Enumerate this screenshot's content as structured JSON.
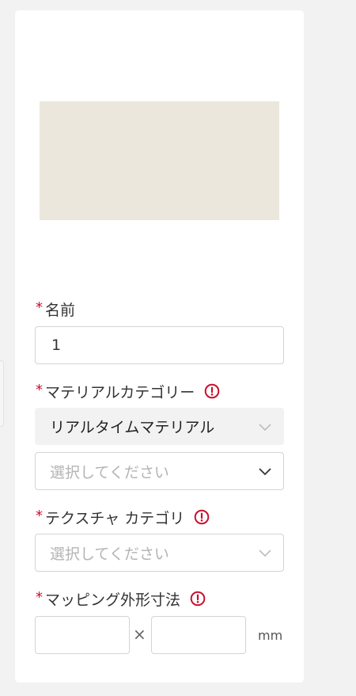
{
  "form": {
    "name": {
      "required_mark": "*",
      "label": "名前",
      "value": "1"
    },
    "material_category": {
      "required_mark": "*",
      "label": "マテリアルカテゴリー",
      "primary_value": "リアルタイムマテリアル",
      "secondary_placeholder": "選択してください"
    },
    "texture_category": {
      "required_mark": "*",
      "label": "テクスチャ カテゴリ",
      "placeholder": "選択してください"
    },
    "mapping_size": {
      "required_mark": "*",
      "label": "マッピング外形寸法",
      "separator": "×",
      "unit": "mm",
      "width_value": "",
      "height_value": ""
    }
  },
  "colors": {
    "required": "#c8102e",
    "preview_fill": "#ebe7dc",
    "page_background": "#f1f2f1"
  },
  "icons": {
    "info": "exclamation-circle-icon",
    "dropdown": "chevron-down-icon"
  }
}
